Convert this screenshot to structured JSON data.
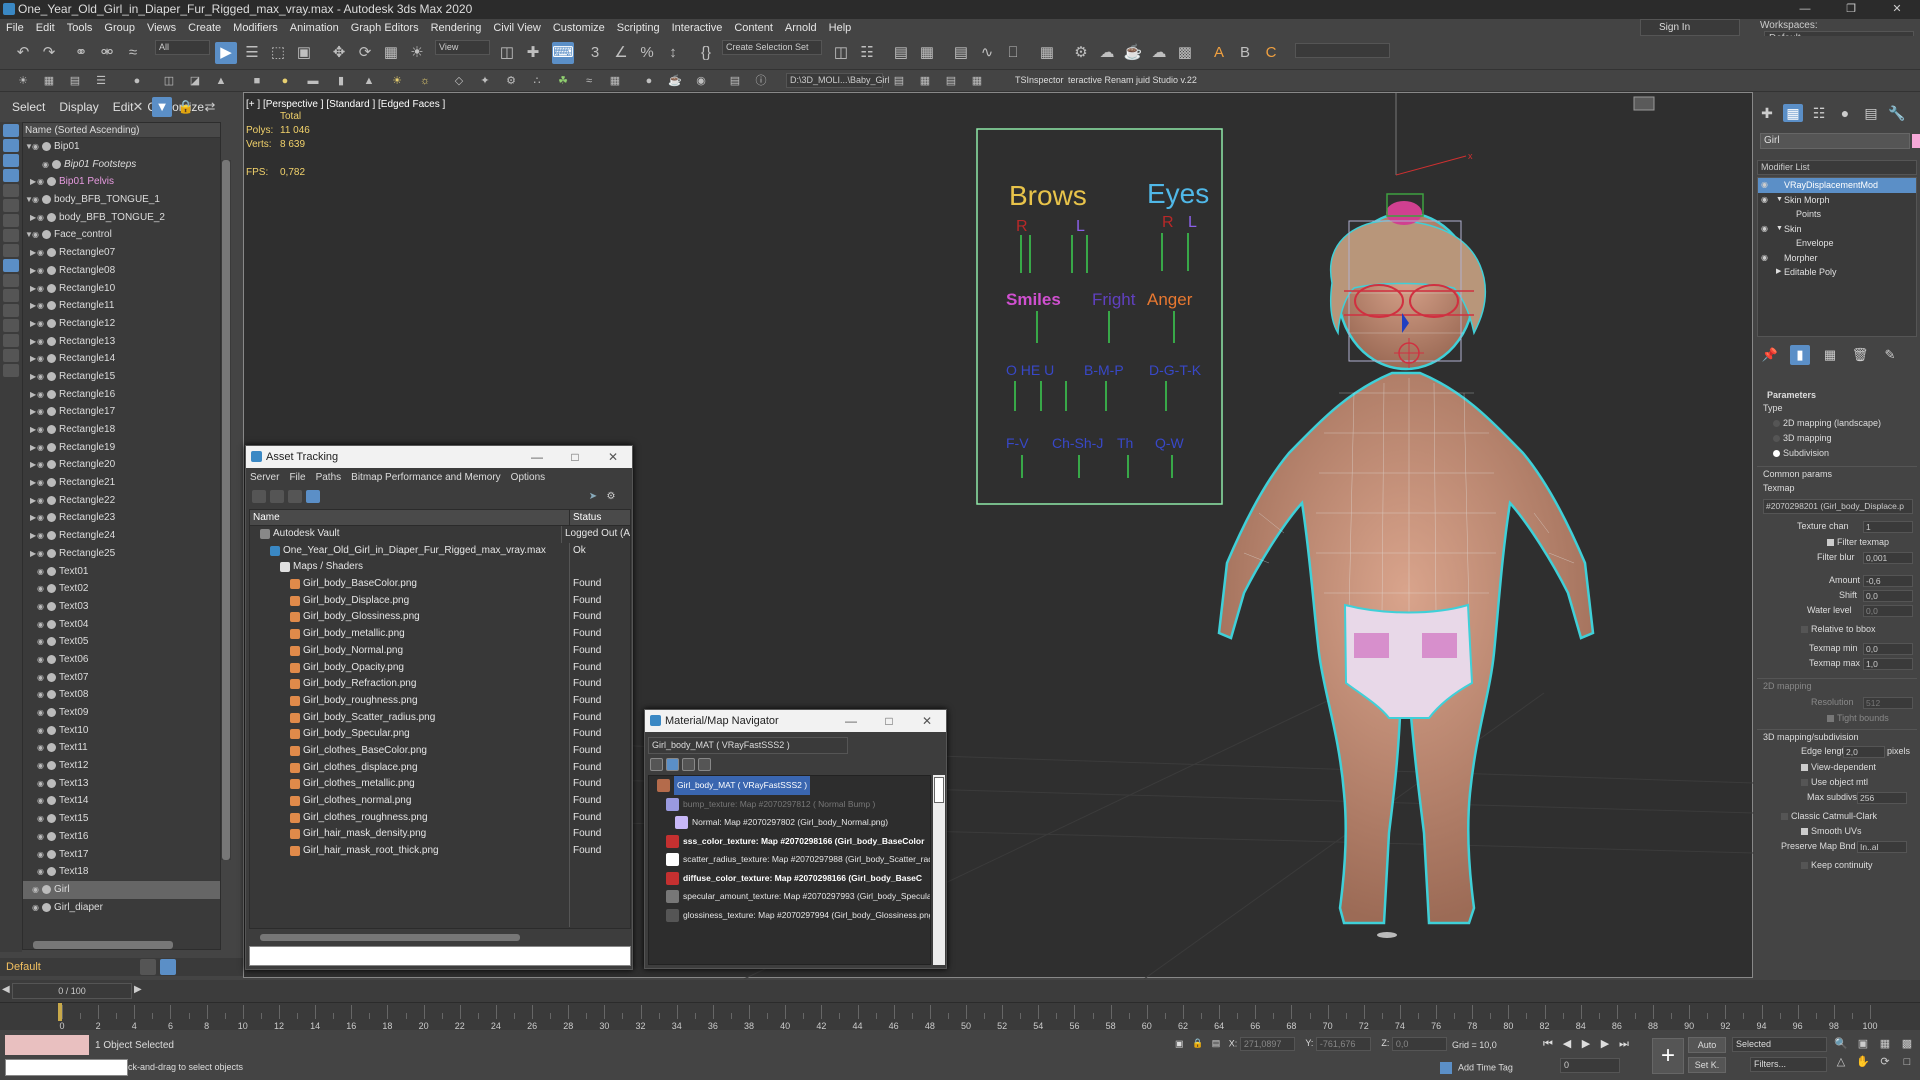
{
  "window": {
    "title": "One_Year_Old_Girl_in_Diaper_Fur_Rigged_max_vray.max - Autodesk 3ds Max 2020"
  },
  "menu": [
    "File",
    "Edit",
    "Tools",
    "Group",
    "Views",
    "Create",
    "Modifiers",
    "Animation",
    "Graph Editors",
    "Rendering",
    "Civil View",
    "Customize",
    "Scripting",
    "Interactive",
    "Content",
    "Arnold",
    "Help"
  ],
  "signin": "Sign In",
  "workspaces": {
    "label": "Workspaces:",
    "value": "Default"
  },
  "toolbar": {
    "filter": "All",
    "refcoord": "View",
    "selset": "Create Selection Set",
    "path": "D:\\3D_MOLI...\\Baby_Girl",
    "tsinspector": "TSInspector",
    "renamer": "teractive Renam juid Studio v.22"
  },
  "scene": {
    "tabs": [
      "Select",
      "Display",
      "Edit",
      "Customize"
    ],
    "header": "Name (Sorted Ascending)",
    "rows": [
      {
        "label": "Bip01",
        "indent": 0,
        "exp": "▼",
        "style": ""
      },
      {
        "label": "Bip01 Footsteps",
        "indent": 2,
        "exp": "",
        "style": "ital"
      },
      {
        "label": "Bip01 Pelvis",
        "indent": 1,
        "exp": "▶",
        "style": "pink"
      },
      {
        "label": "body_BFB_TONGUE_1",
        "indent": 0,
        "exp": "▼",
        "style": ""
      },
      {
        "label": "body_BFB_TONGUE_2",
        "indent": 1,
        "exp": "▶",
        "style": ""
      },
      {
        "label": "Face_control",
        "indent": 0,
        "exp": "▼",
        "style": ""
      },
      {
        "label": "Rectangle07",
        "indent": 1,
        "exp": "▶",
        "style": ""
      },
      {
        "label": "Rectangle08",
        "indent": 1,
        "exp": "▶",
        "style": ""
      },
      {
        "label": "Rectangle10",
        "indent": 1,
        "exp": "▶",
        "style": ""
      },
      {
        "label": "Rectangle11",
        "indent": 1,
        "exp": "▶",
        "style": ""
      },
      {
        "label": "Rectangle12",
        "indent": 1,
        "exp": "▶",
        "style": ""
      },
      {
        "label": "Rectangle13",
        "indent": 1,
        "exp": "▶",
        "style": ""
      },
      {
        "label": "Rectangle14",
        "indent": 1,
        "exp": "▶",
        "style": ""
      },
      {
        "label": "Rectangle15",
        "indent": 1,
        "exp": "▶",
        "style": ""
      },
      {
        "label": "Rectangle16",
        "indent": 1,
        "exp": "▶",
        "style": ""
      },
      {
        "label": "Rectangle17",
        "indent": 1,
        "exp": "▶",
        "style": ""
      },
      {
        "label": "Rectangle18",
        "indent": 1,
        "exp": "▶",
        "style": ""
      },
      {
        "label": "Rectangle19",
        "indent": 1,
        "exp": "▶",
        "style": ""
      },
      {
        "label": "Rectangle20",
        "indent": 1,
        "exp": "▶",
        "style": ""
      },
      {
        "label": "Rectangle21",
        "indent": 1,
        "exp": "▶",
        "style": ""
      },
      {
        "label": "Rectangle22",
        "indent": 1,
        "exp": "▶",
        "style": ""
      },
      {
        "label": "Rectangle23",
        "indent": 1,
        "exp": "▶",
        "style": ""
      },
      {
        "label": "Rectangle24",
        "indent": 1,
        "exp": "▶",
        "style": ""
      },
      {
        "label": "Rectangle25",
        "indent": 1,
        "exp": "▶",
        "style": ""
      },
      {
        "label": "Text01",
        "indent": 1,
        "exp": "",
        "style": ""
      },
      {
        "label": "Text02",
        "indent": 1,
        "exp": "",
        "style": ""
      },
      {
        "label": "Text03",
        "indent": 1,
        "exp": "",
        "style": ""
      },
      {
        "label": "Text04",
        "indent": 1,
        "exp": "",
        "style": ""
      },
      {
        "label": "Text05",
        "indent": 1,
        "exp": "",
        "style": ""
      },
      {
        "label": "Text06",
        "indent": 1,
        "exp": "",
        "style": ""
      },
      {
        "label": "Text07",
        "indent": 1,
        "exp": "",
        "style": ""
      },
      {
        "label": "Text08",
        "indent": 1,
        "exp": "",
        "style": ""
      },
      {
        "label": "Text09",
        "indent": 1,
        "exp": "",
        "style": ""
      },
      {
        "label": "Text10",
        "indent": 1,
        "exp": "",
        "style": ""
      },
      {
        "label": "Text11",
        "indent": 1,
        "exp": "",
        "style": ""
      },
      {
        "label": "Text12",
        "indent": 1,
        "exp": "",
        "style": ""
      },
      {
        "label": "Text13",
        "indent": 1,
        "exp": "",
        "style": ""
      },
      {
        "label": "Text14",
        "indent": 1,
        "exp": "",
        "style": ""
      },
      {
        "label": "Text15",
        "indent": 1,
        "exp": "",
        "style": ""
      },
      {
        "label": "Text16",
        "indent": 1,
        "exp": "",
        "style": ""
      },
      {
        "label": "Text17",
        "indent": 1,
        "exp": "",
        "style": ""
      },
      {
        "label": "Text18",
        "indent": 1,
        "exp": "",
        "style": ""
      },
      {
        "label": "Girl",
        "indent": 0,
        "exp": "",
        "style": "sel"
      },
      {
        "label": "Girl_diaper",
        "indent": 0,
        "exp": "",
        "style": ""
      }
    ],
    "layer": "Default"
  },
  "viewport": {
    "label": "[+ ] [Perspective ] [Standard ] [Edged Faces ]",
    "total_label": "Total",
    "polys_label": "Polys:",
    "polys": "11 046",
    "verts_label": "Verts:",
    "verts": "8 639",
    "fps_label": "FPS:",
    "fps": "0,782",
    "board": {
      "brows": "Brows",
      "eyes": "Eyes",
      "r": "R",
      "l": "L",
      "smiles": "Smiles",
      "fright": "Fright",
      "anger": "Anger",
      "vis1": "O  HE  U",
      "vis2": "B-M-P",
      "vis3": "D-G-T-K",
      "vis4": "F-V",
      "vis5": "Ch-Sh-J",
      "vis6": "Th",
      "vis7": "Q-W"
    },
    "axis_x": "x",
    "axis_z": "z"
  },
  "asset_tracking": {
    "title": "Asset Tracking",
    "menu": [
      "Server",
      "File",
      "Paths",
      "Bitmap Performance and Memory",
      "Options"
    ],
    "col_name": "Name",
    "col_status": "Status",
    "rows": [
      {
        "name": "Autodesk Vault",
        "status": "Logged Out (A",
        "indent": 1,
        "icon": "vault"
      },
      {
        "name": "One_Year_Old_Girl_in_Diaper_Fur_Rigged_max_vray.max",
        "status": "Ok",
        "indent": 2,
        "icon": "max"
      },
      {
        "name": "Maps / Shaders",
        "status": "",
        "indent": 3,
        "icon": "folder"
      },
      {
        "name": "Girl_body_BaseColor.png",
        "status": "Found",
        "indent": 4,
        "icon": "map"
      },
      {
        "name": "Girl_body_Displace.png",
        "status": "Found",
        "indent": 4,
        "icon": "map"
      },
      {
        "name": "Girl_body_Glossiness.png",
        "status": "Found",
        "indent": 4,
        "icon": "map"
      },
      {
        "name": "Girl_body_metallic.png",
        "status": "Found",
        "indent": 4,
        "icon": "map"
      },
      {
        "name": "Girl_body_Normal.png",
        "status": "Found",
        "indent": 4,
        "icon": "map"
      },
      {
        "name": "Girl_body_Opacity.png",
        "status": "Found",
        "indent": 4,
        "icon": "map"
      },
      {
        "name": "Girl_body_Refraction.png",
        "status": "Found",
        "indent": 4,
        "icon": "map"
      },
      {
        "name": "Girl_body_roughness.png",
        "status": "Found",
        "indent": 4,
        "icon": "map"
      },
      {
        "name": "Girl_body_Scatter_radius.png",
        "status": "Found",
        "indent": 4,
        "icon": "map"
      },
      {
        "name": "Girl_body_Specular.png",
        "status": "Found",
        "indent": 4,
        "icon": "map"
      },
      {
        "name": "Girl_clothes_BaseColor.png",
        "status": "Found",
        "indent": 4,
        "icon": "map"
      },
      {
        "name": "Girl_clothes_displace.png",
        "status": "Found",
        "indent": 4,
        "icon": "map"
      },
      {
        "name": "Girl_clothes_metallic.png",
        "status": "Found",
        "indent": 4,
        "icon": "map"
      },
      {
        "name": "Girl_clothes_normal.png",
        "status": "Found",
        "indent": 4,
        "icon": "map"
      },
      {
        "name": "Girl_clothes_roughness.png",
        "status": "Found",
        "indent": 4,
        "icon": "map"
      },
      {
        "name": "Girl_hair_mask_density.png",
        "status": "Found",
        "indent": 4,
        "icon": "map"
      },
      {
        "name": "Girl_hair_mask_root_thick.png",
        "status": "Found",
        "indent": 4,
        "icon": "map"
      },
      {
        "name": "",
        "status": "",
        "indent": 0,
        "icon": ""
      },
      {
        "name": "",
        "status": "",
        "indent": 0,
        "icon": ""
      },
      {
        "name": "",
        "status": "",
        "indent": 0,
        "icon": ""
      },
      {
        "name": "",
        "status": "",
        "indent": 0,
        "icon": ""
      }
    ]
  },
  "navigator": {
    "title": "Material/Map Navigator",
    "field": "Girl_body_MAT  ( VRayFastSSS2 )",
    "rows": [
      {
        "text": "Girl_body_MAT  ( VRayFastSSS2 )",
        "indent": 0,
        "color": "#ffffff",
        "bg": "#3a66b0",
        "icon": "#b46b4b",
        "bold": false
      },
      {
        "text": "bump_texture: Map #2070297812  ( Normal Bump )",
        "indent": 1,
        "color": "#777777",
        "bg": "",
        "icon": "#9a9adf",
        "bold": false
      },
      {
        "text": "Normal: Map #2070297802 (Girl_body_Normal.png)",
        "indent": 2,
        "color": "#e6e6e6",
        "bg": "",
        "icon": "#c8b8f8",
        "bold": false
      },
      {
        "text": "sss_color_texture: Map #2070298166 (Girl_body_BaseColor",
        "indent": 1,
        "color": "#ffffff",
        "bg": "",
        "icon": "#c43030",
        "bold": true
      },
      {
        "text": "scatter_radius_texture: Map #2070297988 (Girl_body_Scatter_radiu",
        "indent": 1,
        "color": "#e6e6e6",
        "bg": "",
        "icon": "#ffffff",
        "bold": false
      },
      {
        "text": "diffuse_color_texture: Map #2070298166 (Girl_body_BaseC",
        "indent": 1,
        "color": "#ffffff",
        "bg": "",
        "icon": "#c43030",
        "bold": true
      },
      {
        "text": "specular_amount_texture: Map #2070297993 (Girl_body_Specular.p",
        "indent": 1,
        "color": "#e6e6e6",
        "bg": "",
        "icon": "#777777",
        "bold": false
      },
      {
        "text": "glossiness_texture: Map #2070297994 (Girl_body_Glossiness.png)",
        "indent": 1,
        "color": "#e6e6e6",
        "bg": "",
        "icon": "#555555",
        "bold": false
      }
    ]
  },
  "command_panel": {
    "object_name": "Girl",
    "modifier_list": "Modifier List",
    "stack": [
      {
        "label": "VRayDisplacementMod",
        "indent": 1,
        "eye": true,
        "sel": true,
        "exp": ""
      },
      {
        "label": "Skin Morph",
        "indent": 1,
        "eye": true,
        "sel": false,
        "exp": "▼"
      },
      {
        "label": "Points",
        "indent": 2,
        "eye": false,
        "sel": false,
        "exp": ""
      },
      {
        "label": "Skin",
        "indent": 1,
        "eye": true,
        "sel": false,
        "exp": "▼"
      },
      {
        "label": "Envelope",
        "indent": 2,
        "eye": false,
        "sel": false,
        "exp": ""
      },
      {
        "label": "Morpher",
        "indent": 1,
        "eye": true,
        "sel": false,
        "exp": ""
      },
      {
        "label": "Editable Poly",
        "indent": 1,
        "eye": false,
        "sel": false,
        "exp": "▶"
      }
    ],
    "params": {
      "header": "Parameters",
      "type_label": "Type",
      "type_opts": [
        "2D mapping (landscape)",
        "3D mapping",
        "Subdivision"
      ],
      "common": "Common params",
      "texmap_label": "Texmap",
      "texmap": "#2070298201 (Girl_body_Displace.p",
      "texture_chan_label": "Texture chan",
      "texture_chan": "1",
      "filter_texmap": "Filter texmap",
      "filter_blur_label": "Filter blur",
      "filter_blur": "0,001",
      "amount_label": "Amount",
      "amount": "-0,6",
      "shift_label": "Shift",
      "shift": "0,0",
      "water_label": "Water level",
      "water": "0,0",
      "relative": "Relative to bbox",
      "texmin_label": "Texmap min",
      "texmin": "0,0",
      "texmax_label": "Texmap max",
      "texmax": "1,0",
      "mapping2d": "2D mapping",
      "resolution_label": "Resolution",
      "resolution": "512",
      "tight": "Tight bounds",
      "mapping3d": "3D mapping/subdivision",
      "edge_label": "Edge length",
      "edge": "2,0",
      "pixels": "pixels",
      "view_dep": "View-dependent",
      "use_obj": "Use object mtl",
      "maxsub_label": "Max subdivs",
      "maxsub": "256",
      "catmull": "Classic Catmull-Clark",
      "smooth_uv": "Smooth UVs",
      "preserve_label": "Preserve Map Bnd",
      "preserve": "In..al",
      "keep_cont": "Keep continuity"
    }
  },
  "timeline": {
    "slider": "0 / 100",
    "ticks": [
      "0",
      "2",
      "4",
      "6",
      "8",
      "10",
      "12",
      "14",
      "16",
      "18",
      "20",
      "22",
      "24",
      "26",
      "28",
      "30",
      "32",
      "34",
      "36",
      "38",
      "40",
      "42",
      "44",
      "46",
      "48",
      "50",
      "52",
      "54",
      "56",
      "58",
      "60",
      "62",
      "64",
      "66",
      "68",
      "70",
      "72",
      "74",
      "76",
      "78",
      "80",
      "82",
      "84",
      "86",
      "88",
      "90",
      "92",
      "94",
      "96",
      "98",
      "100"
    ]
  },
  "status": {
    "selected": "1 Object Selected",
    "prompt": "ck-and-drag to select objects",
    "x_label": "X:",
    "x": "271,0897",
    "y_label": "Y:",
    "y": "-761,676",
    "z_label": "Z:",
    "z": "0,0",
    "grid": "Grid = 10,0",
    "add_time_tag": "Add Time Tag",
    "frame": "0",
    "auto": "Auto",
    "selected_dd": "Selected",
    "setk": "Set K.",
    "filters": "Filters..."
  }
}
